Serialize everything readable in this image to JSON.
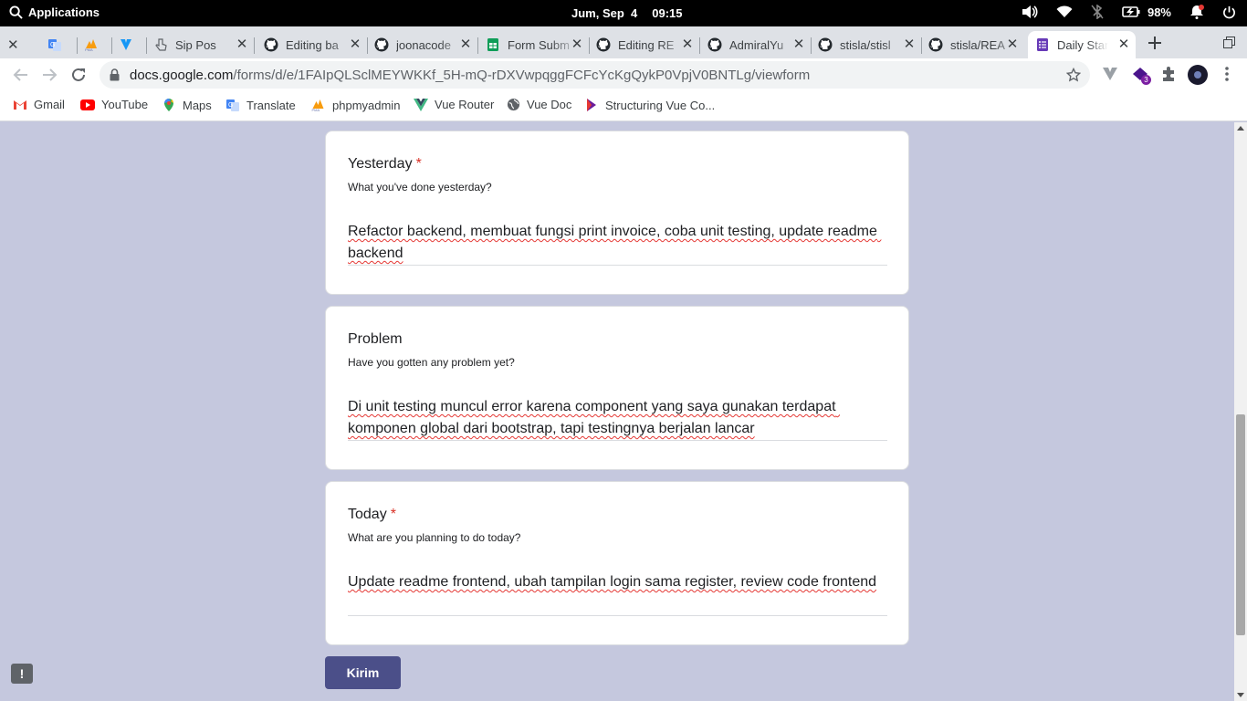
{
  "system": {
    "menu": "Applications",
    "date": "Jum, Sep  4",
    "time": "09:15",
    "battery": "98%"
  },
  "tabs": [
    {
      "title": "",
      "icon": "google-translate-icon"
    },
    {
      "title": "",
      "icon": "phpmyadmin-icon"
    },
    {
      "title": "",
      "icon": "vuetify-icon"
    },
    {
      "title": "Sip Pos",
      "icon": "hand-pointer-icon"
    },
    {
      "title": "Editing ba",
      "icon": "github-icon"
    },
    {
      "title": "joonacode",
      "icon": "github-icon"
    },
    {
      "title": "Form Subm",
      "icon": "google-sheets-icon"
    },
    {
      "title": "Editing RE",
      "icon": "github-icon"
    },
    {
      "title": "AdmiralYu",
      "icon": "github-icon"
    },
    {
      "title": "stisla/stisl",
      "icon": "github-icon"
    },
    {
      "title": "stisla/REA",
      "icon": "github-icon"
    },
    {
      "title": "Daily Stan",
      "icon": "google-forms-icon",
      "active": true
    }
  ],
  "address": {
    "domain": "docs.google.com",
    "path": "/forms/d/e/1FAIpQLSclMEYWKKf_5H-mQ-rDXVwpqggFCFcYcKgQykP0VpjV0BNTLg/viewform"
  },
  "bookmarks": [
    "Gmail",
    "YouTube",
    "Maps",
    "Translate",
    "phpmyadmin",
    "Vue Router",
    "Vue Doc",
    "Structuring Vue Co..."
  ],
  "questions": [
    {
      "title": "Yesterday",
      "required": true,
      "desc": "What you've done yesterday?",
      "answer": "Refactor backend, membuat fungsi print invoice, coba unit testing, update readme backend"
    },
    {
      "title": "Problem",
      "required": false,
      "desc": "Have you gotten any problem yet?",
      "answer": "Di unit testing muncul error karena component yang saya gunakan terdapat komponen global dari bootstrap, tapi testingnya berjalan lancar"
    },
    {
      "title": "Today",
      "required": true,
      "desc": "What are you planning to do today?",
      "answer": "Update readme frontend, ubah tampilan login sama register, review code frontend"
    }
  ],
  "submit_label": "Kirim",
  "report_label": "!",
  "extensions_badge": "3",
  "colors": {
    "page_bg": "#c5c8de",
    "button": "#4b4f89",
    "required": "#d93025"
  }
}
